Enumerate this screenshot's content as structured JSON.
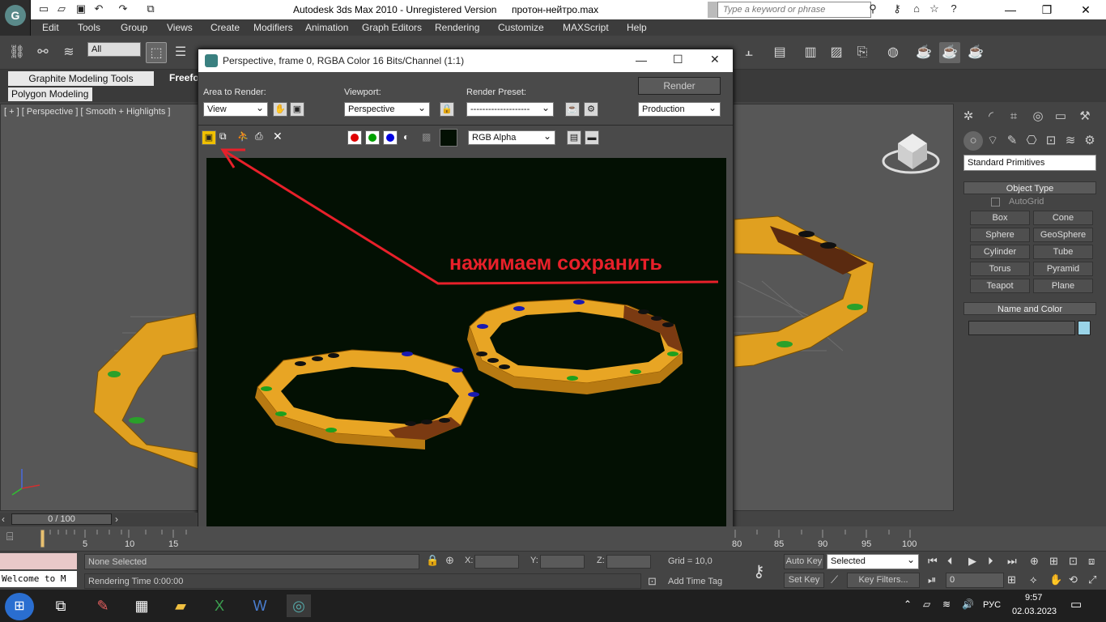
{
  "window": {
    "title": "Autodesk 3ds Max  2010  - Unregistered Version",
    "file": "протон-нейтро.max",
    "search_placeholder": "Type a keyword or phrase"
  },
  "menu": [
    "Edit",
    "Tools",
    "Group",
    "Views",
    "Create",
    "Modifiers",
    "Animation",
    "Graph Editors",
    "Rendering",
    "Customize",
    "MAXScript",
    "Help"
  ],
  "toolbar": {
    "selection_filter": "All"
  },
  "ribbon": {
    "tab_graphite": "Graphite Modeling Tools",
    "tab_freeform": "Freeform",
    "panel_poly": "Polygon Modeling"
  },
  "viewport": {
    "label": "[ + ] [ Perspective ] [ Smooth + Highlights ]"
  },
  "render_window": {
    "title": "Perspective, frame 0, RGBA Color 16 Bits/Channel (1:1)",
    "area_label": "Area to Render:",
    "area_value": "View",
    "viewport_label": "Viewport:",
    "viewport_value": "Perspective",
    "preset_label": "Render Preset:",
    "preset_value": "--------------------",
    "render_button": "Render",
    "production_value": "Production",
    "channel_value": "RGB Alpha",
    "annotation": "нажимаем сохранить"
  },
  "command_panel": {
    "category": "Standard Primitives",
    "object_type": "Object Type",
    "autogrid": "AutoGrid",
    "buttons": [
      "Box",
      "Cone",
      "Sphere",
      "GeoSphere",
      "Cylinder",
      "Tube",
      "Torus",
      "Pyramid",
      "Teapot",
      "Plane"
    ],
    "name_color": "Name and Color"
  },
  "timeline": {
    "slider": "0 / 100",
    "ticks": [
      "5",
      "10",
      "15",
      "80",
      "85",
      "90",
      "95",
      "100"
    ]
  },
  "status": {
    "none_selected": "None Selected",
    "rendering_time": "Rendering Time  0:00:00",
    "welcome": "Welcome to M",
    "x_label": "X:",
    "y_label": "Y:",
    "z_label": "Z:",
    "grid": "Grid = 10,0",
    "add_time_tag": "Add Time Tag",
    "auto_key": "Auto Key",
    "set_key": "Set Key",
    "selected": "Selected",
    "key_filters": "Key Filters...",
    "frame": "0"
  },
  "taskbar": {
    "lang": "РУС",
    "time": "9:57",
    "date": "02.03.2023"
  },
  "colors": {
    "ring": "#e0a020",
    "annotation": "#e8202a"
  }
}
